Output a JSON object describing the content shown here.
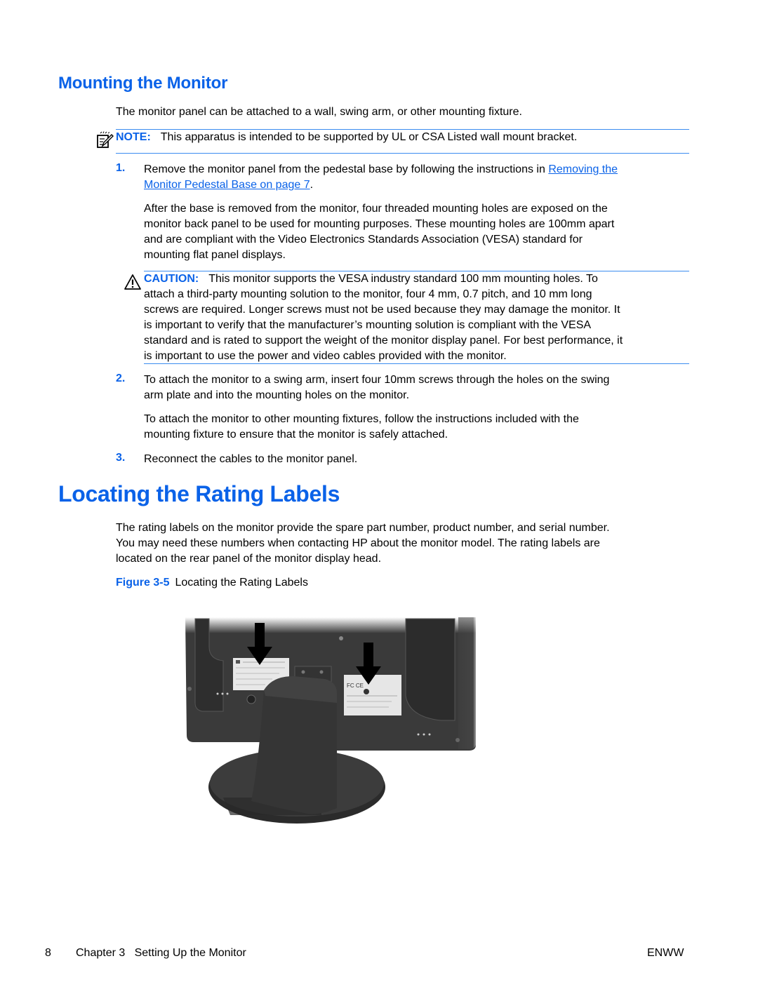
{
  "section": {
    "title": "Mounting the Monitor",
    "intro": "The monitor panel can be attached to a wall, swing arm, or other mounting fixture.",
    "note": {
      "icon": "note-pencil-icon",
      "label": "NOTE:",
      "text": "This apparatus is intended to be supported by UL or CSA Listed wall mount bracket."
    },
    "steps": [
      {
        "number": "1.",
        "text_before_link": "Remove the monitor panel from the pedestal base by following the instructions in ",
        "link_line1": "Removing the",
        "link_line2": "Monitor Pedestal Base on page 7",
        "text_after_link": ".",
        "paragraph": [
          "After the base is removed from the monitor, four threaded mounting holes are exposed on the",
          "monitor back panel to be used for mounting purposes. These mounting holes are 100mm apart",
          "and are compliant with the Video Electronics Standards Association (VESA) standard for",
          "mounting flat panel displays."
        ],
        "caution": {
          "icon": "warning-triangle-icon",
          "label": "CAUTION:",
          "lines": [
            "This monitor supports the VESA industry standard 100 mm mounting holes. To",
            "attach a third-party mounting solution to the monitor, four 4 mm, 0.7 pitch, and 10 mm long",
            "screws are required. Longer screws must not be used because they may damage the monitor. It",
            "is important to verify that the manufacturer’s mounting solution is compliant with the VESA",
            "standard and is rated to support the weight of the monitor display panel. For best performance, it",
            "is important to use the power and video cables provided with the monitor."
          ]
        }
      },
      {
        "number": "2.",
        "lines": [
          "To attach the monitor to a swing arm, insert four 10mm screws through the holes on the swing",
          "arm plate and into the mounting holes on the monitor."
        ],
        "paragraph": [
          "To attach the monitor to other mounting fixtures, follow the instructions included with the",
          "mounting fixture to ensure that the monitor is safely attached."
        ]
      },
      {
        "number": "3.",
        "lines": [
          "Reconnect the cables to the monitor panel."
        ]
      }
    ]
  },
  "rating": {
    "title": "Locating the Rating Labels",
    "lines": [
      "The rating labels on the monitor provide the spare part number, product number, and serial number.",
      "You may need these numbers when contacting HP about the monitor model. The rating labels are",
      "located on the rear panel of the monitor display head."
    ],
    "figure": {
      "label": "Figure 3-5",
      "caption": "Locating the Rating Labels",
      "image_description": "Rear view of monitor on pedestal base with two arrows pointing to rating labels"
    }
  },
  "footer": {
    "page_number": "8",
    "chapter": "Chapter 3   Setting Up the Monitor",
    "code": "ENWW"
  },
  "colors": {
    "heading": "#0a62e8",
    "rule": "#3b8cf0"
  }
}
